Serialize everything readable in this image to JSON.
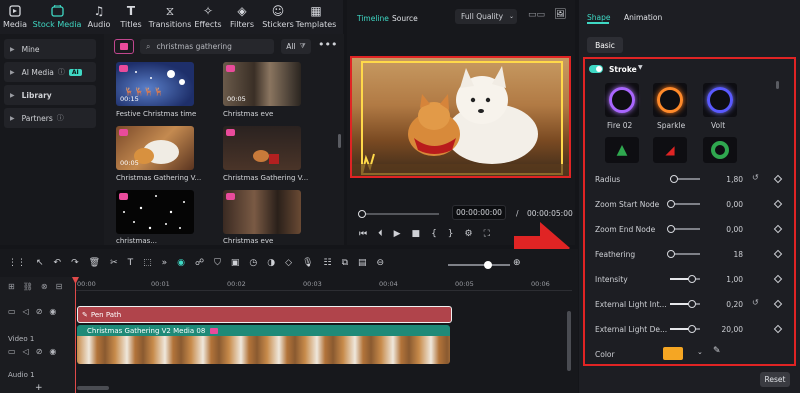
{
  "toolbar": {
    "items": [
      {
        "label": "Media",
        "icon": "media-icon"
      },
      {
        "label": "Stock Media",
        "icon": "stock-media-icon"
      },
      {
        "label": "Audio",
        "icon": "audio-icon"
      },
      {
        "label": "Titles",
        "icon": "titles-icon"
      },
      {
        "label": "Transitions",
        "icon": "transitions-icon"
      },
      {
        "label": "Effects",
        "icon": "effects-icon"
      },
      {
        "label": "Filters",
        "icon": "filters-icon"
      },
      {
        "label": "Stickers",
        "icon": "stickers-icon"
      },
      {
        "label": "Templates",
        "icon": "templates-icon"
      }
    ]
  },
  "sidebar": {
    "items": [
      {
        "label": "Mine"
      },
      {
        "label": "AI Media",
        "badge": "AI"
      },
      {
        "label": "Library"
      },
      {
        "label": "Partners"
      }
    ]
  },
  "media": {
    "search_value": "christmas gathering",
    "filter_label": "All",
    "items": [
      {
        "label": "Festive Christmas time",
        "duration": "00:15"
      },
      {
        "label": "Christmas eve",
        "duration": "00:05"
      },
      {
        "label": "Christmas Gathering V...",
        "duration": "00:05"
      },
      {
        "label": "Christmas Gathering V...",
        "duration": ""
      },
      {
        "label": "christmas...",
        "duration": ""
      },
      {
        "label": "Christmas eve",
        "duration": ""
      }
    ]
  },
  "preview": {
    "tab_timeline": "Timeline",
    "tab_source": "Source",
    "quality": "Full Quality",
    "time_current": "00:00:00:00",
    "time_sep": "/",
    "time_total": "00:00:05:00"
  },
  "panel": {
    "tab_shape": "Shape",
    "tab_animation": "Animation",
    "basic": "Basic",
    "stroke_label": "Stroke",
    "presets_row1": [
      "Fire 02",
      "Sparkle",
      "Volt"
    ],
    "rows": [
      {
        "label": "Radius",
        "value": "1,80",
        "reset": true,
        "pos": 0.1
      },
      {
        "label": "Zoom Start Node",
        "value": "0,00",
        "reset": false,
        "pos": 0.0
      },
      {
        "label": "Zoom End Node",
        "value": "0,00",
        "reset": false,
        "pos": 0.0
      },
      {
        "label": "Feathering",
        "value": "18",
        "reset": false,
        "pos": 0.0
      },
      {
        "label": "Intensity",
        "value": "1,00",
        "reset": false,
        "pos": 0.7
      },
      {
        "label": "External Light Int...",
        "value": "0,20",
        "reset": true,
        "pos": 0.7
      },
      {
        "label": "External Light De...",
        "value": "20,00",
        "reset": false,
        "pos": 0.7
      }
    ],
    "color_label": "Color",
    "color_value": "#f5a623",
    "reset_button": "Reset"
  },
  "timeline": {
    "ruler": [
      "00:00",
      "00:01",
      "00:02",
      "00:03",
      "00:04",
      "00:05",
      "00:06"
    ],
    "fx_clip": "Pen Path",
    "video_clip": "Christmas Gathering V2 Media 08",
    "track_video": "Video 1",
    "track_audio": "Audio 1"
  },
  "colors": {
    "accent": "#3fd8c4",
    "highlight_red": "#e02424",
    "fx_clip": "#b0444b",
    "video_clip": "#1f8a78"
  }
}
